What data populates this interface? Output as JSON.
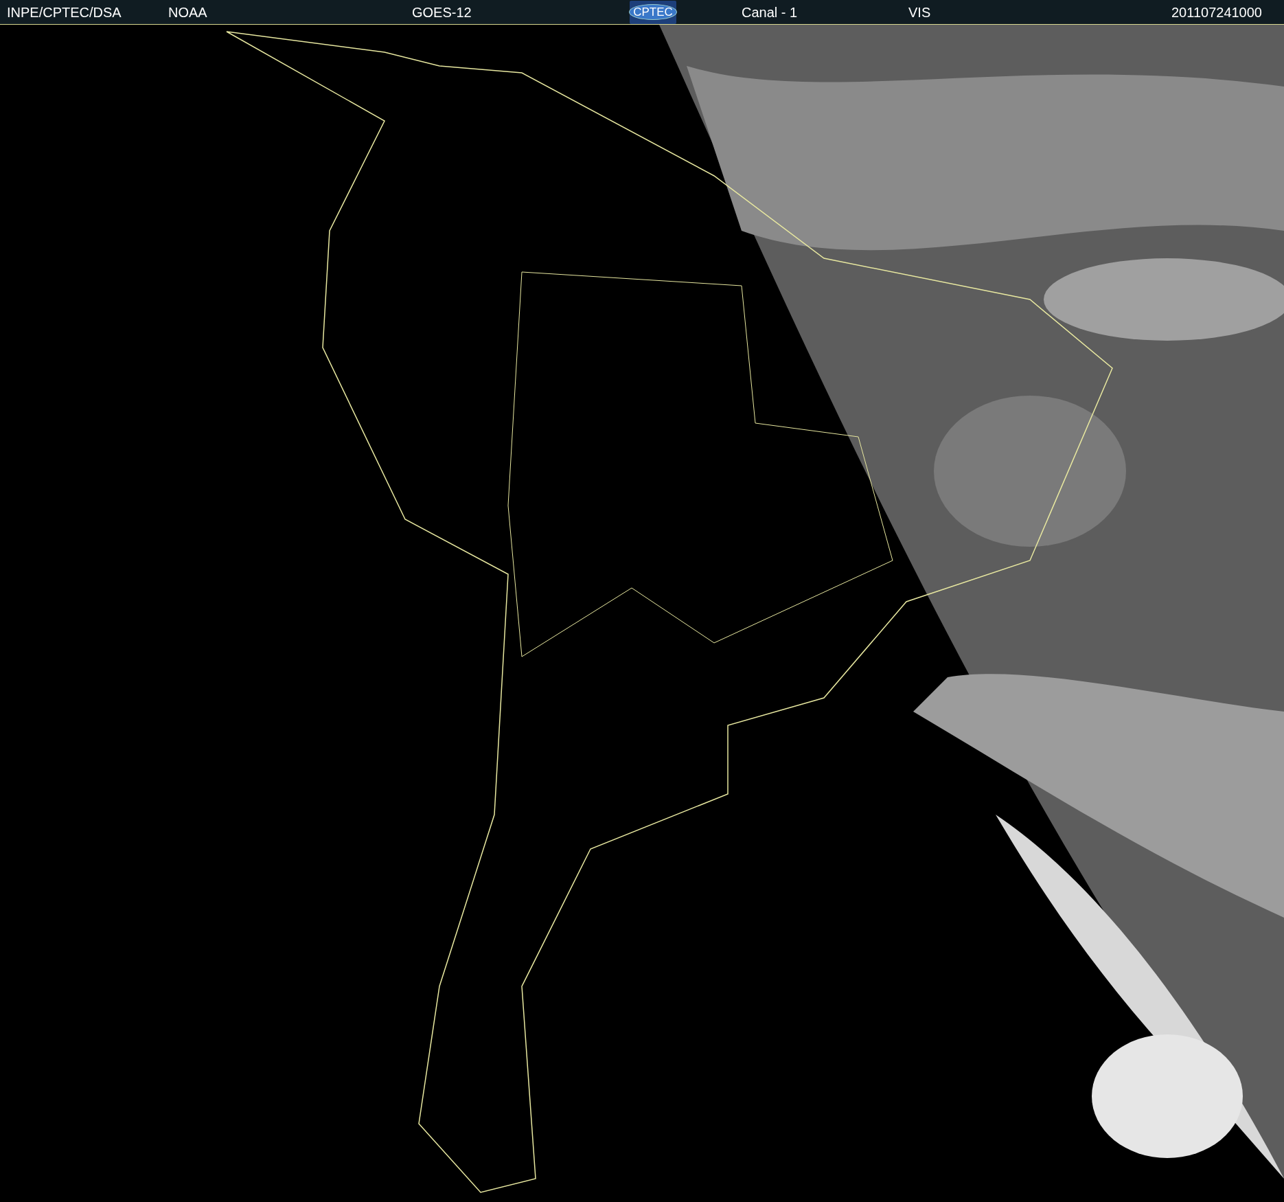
{
  "header": {
    "items": [
      {
        "kind": "text",
        "text": "INPE/CPTEC/DSA"
      },
      {
        "kind": "text",
        "text": "NOAA"
      },
      {
        "kind": "text",
        "text": "GOES-12"
      },
      {
        "kind": "logo",
        "text": "CPTEC"
      },
      {
        "kind": "text",
        "text": "Canal - 1"
      },
      {
        "kind": "text",
        "text": "VIS"
      },
      {
        "kind": "text",
        "text": "201107241000"
      }
    ]
  }
}
